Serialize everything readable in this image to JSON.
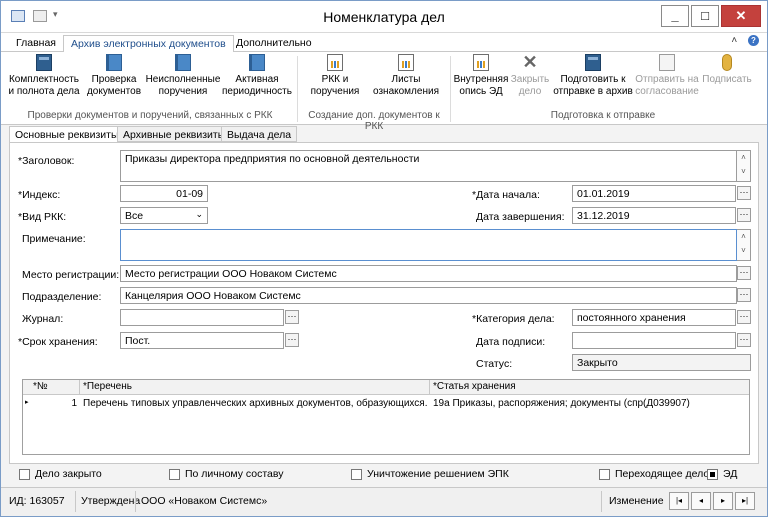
{
  "window": {
    "title": "Номенклатура дел"
  },
  "menu_tabs": [
    "Главная",
    "Архив электронных документов",
    "Дополнительно"
  ],
  "ribbon": {
    "group1": {
      "label": "Проверки документов и поручений, связанных с РКК",
      "buttons": [
        {
          "l1": "Комплектность",
          "l2": "и полнота дела"
        },
        {
          "l1": "Проверка",
          "l2": "документов"
        },
        {
          "l1": "Неисполненные",
          "l2": "поручения"
        },
        {
          "l1": "Активная",
          "l2": "периодичность"
        }
      ]
    },
    "group2": {
      "label": "Создание доп. документов к РКК",
      "buttons": [
        {
          "l1": "РКК и",
          "l2": "поручения"
        },
        {
          "l1": "Листы",
          "l2": "ознакомления"
        }
      ]
    },
    "group3": {
      "label": "Подготовка к отправке",
      "buttons": [
        {
          "l1": "Внутренняя",
          "l2": "опись ЭД"
        },
        {
          "l1": "Закрыть",
          "l2": "дело"
        },
        {
          "l1": "Подготовить к",
          "l2": "отправке в архив"
        },
        {
          "l1": "Отправить на",
          "l2": "согласование"
        },
        {
          "l1": "Подписать",
          "l2": ""
        }
      ]
    }
  },
  "sub_tabs": [
    "Основные реквизиты",
    "Архивные реквизиты",
    "Выдача дела"
  ],
  "form": {
    "zagolovok_label": "*Заголовок:",
    "zagolovok_value": "Приказы директора предприятия по основной деятельности",
    "index_label": "*Индекс:",
    "index_value": "01-09",
    "vid_label": "*Вид РКК:",
    "vid_value": "Все",
    "date_start_label": "*Дата начала:",
    "date_start_value": "01.01.2019",
    "date_end_label": "Дата завершения:",
    "date_end_value": "31.12.2019",
    "note_label": "Примечание:",
    "note_value": "",
    "place_label": "Место регистрации:",
    "place_value": "Место регистрации ООО Новаком Системс",
    "dept_label": "Подразделение:",
    "dept_value": "Канцелярия ООО Новаком Системс",
    "journal_label": "Журнал:",
    "journal_value": "",
    "category_label": "*Категория дела:",
    "category_value": "постоянного хранения",
    "term_label": "*Срок хранения:",
    "term_value": "Пост.",
    "sign_date_label": "Дата подписи:",
    "sign_date_value": "",
    "status_label": "Статус:",
    "status_value": "Закрыто"
  },
  "grid": {
    "headers": [
      "*№",
      "*Перечень",
      "*Статья хранения"
    ],
    "rows": [
      {
        "num": "1",
        "list": "Перечень типовых управленческих архивных документов, образующихся...",
        "article": "19а Приказы, распоряжения; документы (спр(Д039907)"
      }
    ]
  },
  "checks": {
    "closed": "Дело закрыто",
    "personal": "По личному составу",
    "destroy": "Уничтожение решением ЭПК",
    "transit": "Переходящее дело",
    "ed": "ЭД"
  },
  "statusbar": {
    "id": "ИД: 163057",
    "state": "Утверждена",
    "org": "ООО «Новаком Системс»",
    "mode": "Изменение"
  },
  "icons": [
    "film-icon",
    "book-icon",
    "chart-icon",
    "x-icon",
    "document-icon",
    "medal-icon"
  ],
  "accent_color": "#1f4e8c",
  "close_color": "#c4413d"
}
